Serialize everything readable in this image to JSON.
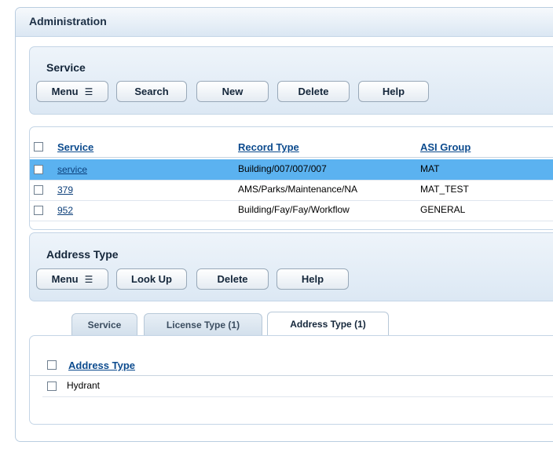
{
  "panel": {
    "title": "Administration"
  },
  "service": {
    "title": "Service",
    "buttons": {
      "menu": "Menu",
      "search": "Search",
      "new": "New",
      "delete": "Delete",
      "help": "Help"
    }
  },
  "service_table": {
    "columns": [
      "Service",
      "Record Type",
      "ASI Group"
    ],
    "rows": [
      {
        "service": "service",
        "record_type": "Building/007/007/007",
        "asi_group": "MAT",
        "selected": true
      },
      {
        "service": "379",
        "record_type": "AMS/Parks/Maintenance/NA",
        "asi_group": "MAT_TEST",
        "selected": false
      },
      {
        "service": "952",
        "record_type": "Building/Fay/Fay/Workflow",
        "asi_group": "GENERAL",
        "selected": false
      }
    ]
  },
  "address_type": {
    "title": "Address Type",
    "buttons": {
      "menu": "Menu",
      "lookup": "Look Up",
      "delete": "Delete",
      "help": "Help"
    }
  },
  "tabs": [
    {
      "label": "Service",
      "active": false
    },
    {
      "label": "License Type (1)",
      "active": false
    },
    {
      "label": "Address Type (1)",
      "active": true
    }
  ],
  "address_table": {
    "columns": [
      "Address Type"
    ],
    "rows": [
      {
        "address_type": "Hydrant"
      }
    ]
  },
  "icons": {
    "menu": "hamburger-icon"
  },
  "colors": {
    "selected_row": "#5bb2f0",
    "header_link": "#0c4b8e"
  }
}
